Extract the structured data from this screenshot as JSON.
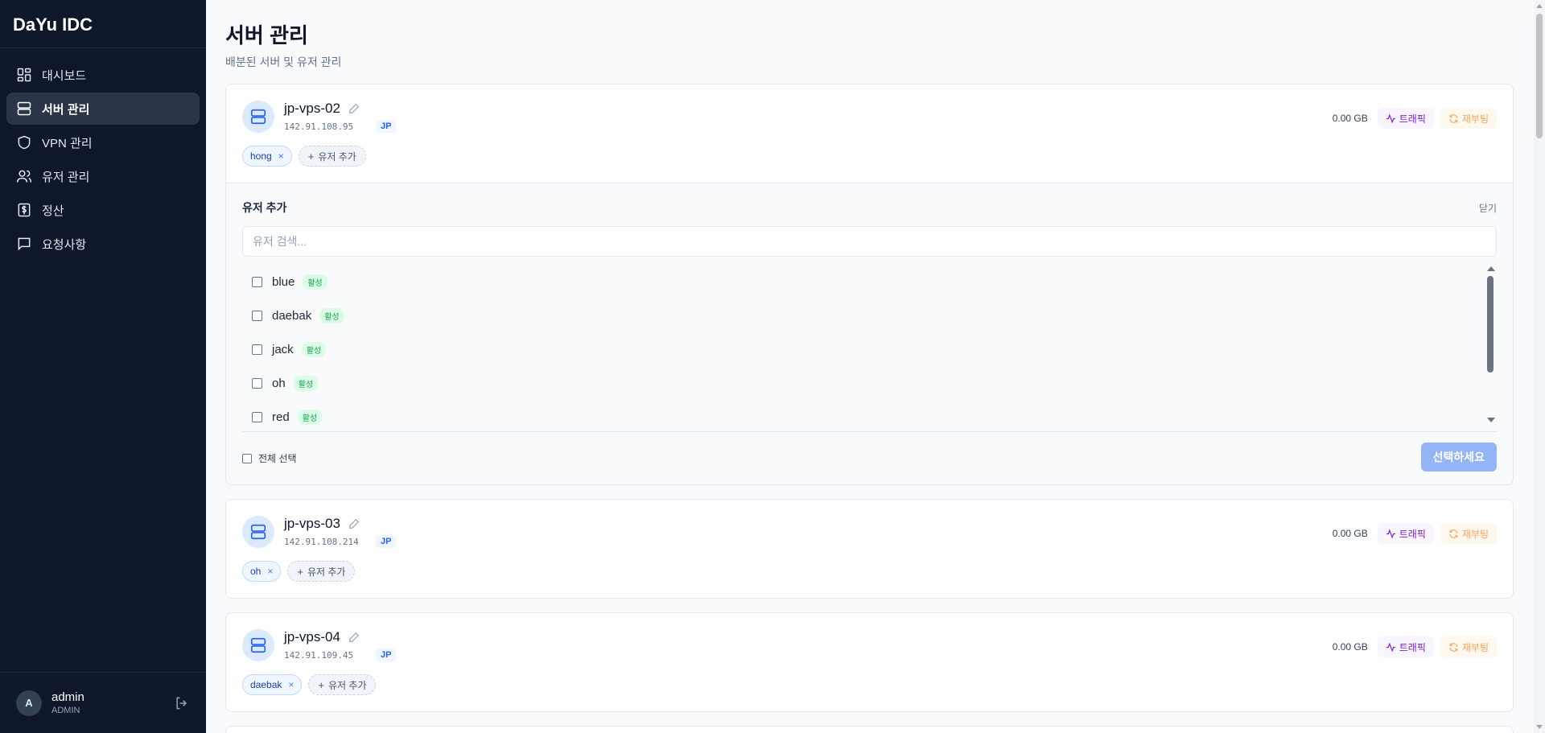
{
  "brand": "DaYu IDC",
  "nav": [
    {
      "label": "대시보드",
      "icon": "dashboard-icon",
      "active": false
    },
    {
      "label": "서버 관리",
      "icon": "server-icon",
      "active": true
    },
    {
      "label": "VPN 관리",
      "icon": "shield-icon",
      "active": false
    },
    {
      "label": "유저 관리",
      "icon": "users-icon",
      "active": false
    },
    {
      "label": "정산",
      "icon": "dollar-receipt-icon",
      "active": false
    },
    {
      "label": "요청사항",
      "icon": "message-icon",
      "active": false
    }
  ],
  "user": {
    "initial": "A",
    "name": "admin",
    "role": "ADMIN"
  },
  "page": {
    "title": "서버 관리",
    "subtitle": "배분된 서버 및 유저 관리"
  },
  "common": {
    "add_user": "유저 추가",
    "traffic": "트래픽",
    "reboot": "재부팅",
    "tag_remove": "×",
    "plus": "+"
  },
  "servers": [
    {
      "name": "jp-vps-02",
      "ip": "142.91.108.95",
      "region": "JP",
      "usage": "0.00 GB",
      "users": [
        "hong"
      ]
    },
    {
      "name": "jp-vps-03",
      "ip": "142.91.108.214",
      "region": "JP",
      "usage": "0.00 GB",
      "users": [
        "oh"
      ]
    },
    {
      "name": "jp-vps-04",
      "ip": "142.91.109.45",
      "region": "JP",
      "usage": "0.00 GB",
      "users": [
        "daebak"
      ]
    }
  ],
  "add_panel": {
    "title": "유저 추가",
    "close": "닫기",
    "search_placeholder": "유저 검색...",
    "candidates": [
      {
        "name": "blue",
        "status": "활성"
      },
      {
        "name": "daebak",
        "status": "활성"
      },
      {
        "name": "jack",
        "status": "활성"
      },
      {
        "name": "oh",
        "status": "활성"
      },
      {
        "name": "red",
        "status": "활성"
      }
    ],
    "select_all": "전체 선택",
    "confirm": "선택하세요"
  },
  "colors": {
    "sidebar_bg": "#0f172a",
    "accent": "#2563eb",
    "traffic": "#7e22ce",
    "reboot": "#fb923c",
    "active_status": "#16a34a"
  }
}
